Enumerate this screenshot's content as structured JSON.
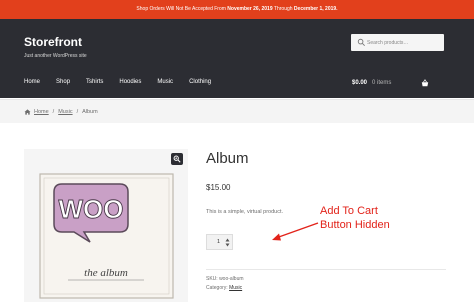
{
  "notice": {
    "prefix": "Shop Orders Will Not Be Accepted From ",
    "from_date": "November 26, 2019",
    "middle": " Through ",
    "to_date": "December 1, 2019."
  },
  "header": {
    "brand": "Storefront",
    "tagline": "Just another WordPress site",
    "search_placeholder": "Search products…"
  },
  "nav": {
    "items": [
      "Home",
      "Shop",
      "Tshirts",
      "Hoodies",
      "Music",
      "Clothing"
    ]
  },
  "cart": {
    "total": "$0.00",
    "count": "0 items"
  },
  "breadcrumb": {
    "home": "Home",
    "category": "Music",
    "current": "Album",
    "separator": "/"
  },
  "product": {
    "title": "Album",
    "price": "$15.00",
    "description": "This is a simple, virtual product.",
    "quantity": "1",
    "sku_label": "SKU:",
    "sku_value": "woo-album",
    "category_label": "Category:",
    "category_value": "Music",
    "album_logo": "WOO",
    "album_caption": "the album"
  },
  "annotation": {
    "line1": "Add To Cart",
    "line2": "Button Hidden",
    "color": "#e2231a"
  },
  "colors": {
    "notice_bg": "#e2401c",
    "header_bg": "#2c2d33",
    "woo_purple": "#9b5c8f"
  }
}
